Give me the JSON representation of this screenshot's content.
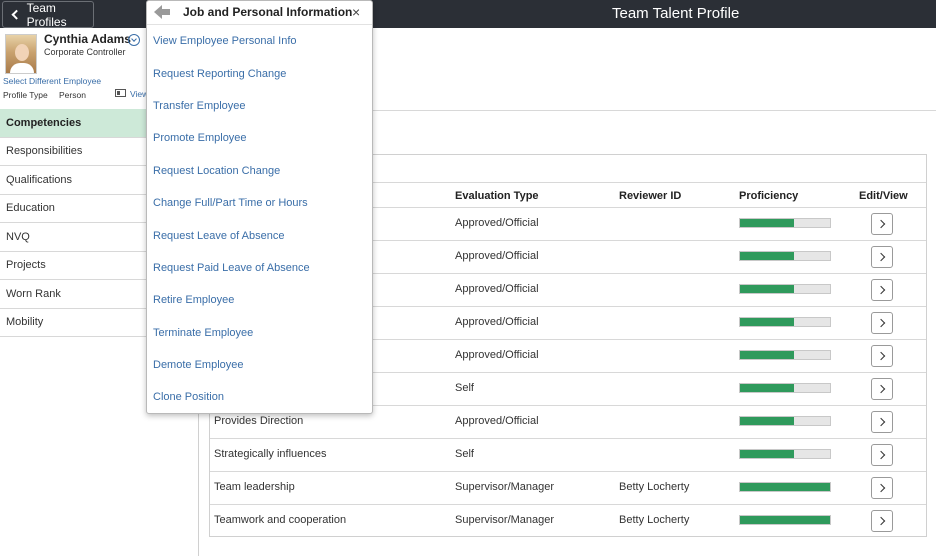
{
  "topbar": {
    "back_label": "Team Profiles",
    "title": "Team Talent Profile"
  },
  "profile": {
    "name": "Cynthia Adams",
    "title": "Corporate Controller",
    "select_link": "Select Different Employee",
    "profile_type_label": "Profile Type",
    "profile_type_value": "Person",
    "view_link": "View"
  },
  "sidebar": {
    "items": [
      {
        "label": "Competencies"
      },
      {
        "label": "Responsibilities"
      },
      {
        "label": "Qualifications"
      },
      {
        "label": "Education"
      },
      {
        "label": "NVQ"
      },
      {
        "label": "Projects"
      },
      {
        "label": "Worn Rank"
      },
      {
        "label": "Mobility"
      }
    ]
  },
  "grid": {
    "headers": {
      "evaluation": "Evaluation Type",
      "reviewer": "Reviewer ID",
      "proficiency": "Proficiency",
      "edit": "Edit/View"
    },
    "rows": [
      {
        "competency": "",
        "evaluation": "Approved/Official",
        "reviewer": "",
        "proficiency": 0.6
      },
      {
        "competency": "",
        "evaluation": "Approved/Official",
        "reviewer": "",
        "proficiency": 0.6
      },
      {
        "competency": "",
        "evaluation": "Approved/Official",
        "reviewer": "",
        "proficiency": 0.6
      },
      {
        "competency": "",
        "evaluation": "Approved/Official",
        "reviewer": "",
        "proficiency": 0.6
      },
      {
        "competency": "",
        "evaluation": "Approved/Official",
        "reviewer": "",
        "proficiency": 0.6
      },
      {
        "competency": "",
        "evaluation": "Self",
        "reviewer": "",
        "proficiency": 0.6
      },
      {
        "competency": "Provides Direction",
        "evaluation": "Approved/Official",
        "reviewer": "",
        "proficiency": 0.6
      },
      {
        "competency": "Strategically influences",
        "evaluation": "Self",
        "reviewer": "",
        "proficiency": 0.6
      },
      {
        "competency": "Team leadership",
        "evaluation": "Supervisor/Manager",
        "reviewer": "Betty Locherty",
        "proficiency": 1.0
      },
      {
        "competency": "Teamwork and cooperation",
        "evaluation": "Supervisor/Manager",
        "reviewer": "Betty Locherty",
        "proficiency": 1.0
      }
    ]
  },
  "popup": {
    "title": "Job and Personal Information",
    "close": "×",
    "items": [
      {
        "label": "View Employee Personal Info"
      },
      {
        "label": "Request Reporting Change"
      },
      {
        "label": "Transfer Employee"
      },
      {
        "label": "Promote Employee"
      },
      {
        "label": "Request Location Change"
      },
      {
        "label": "Change Full/Part Time or Hours"
      },
      {
        "label": "Request Leave of Absence"
      },
      {
        "label": "Request Paid Leave of Absence"
      },
      {
        "label": "Retire Employee"
      },
      {
        "label": "Terminate Employee"
      },
      {
        "label": "Demote Employee"
      },
      {
        "label": "Clone Position"
      }
    ]
  },
  "colors": {
    "accent": "#3a6ea8",
    "active_nav": "#cde9d8",
    "proficiency_fill": "#2f9a5c",
    "topbar": "#2b2f36"
  }
}
